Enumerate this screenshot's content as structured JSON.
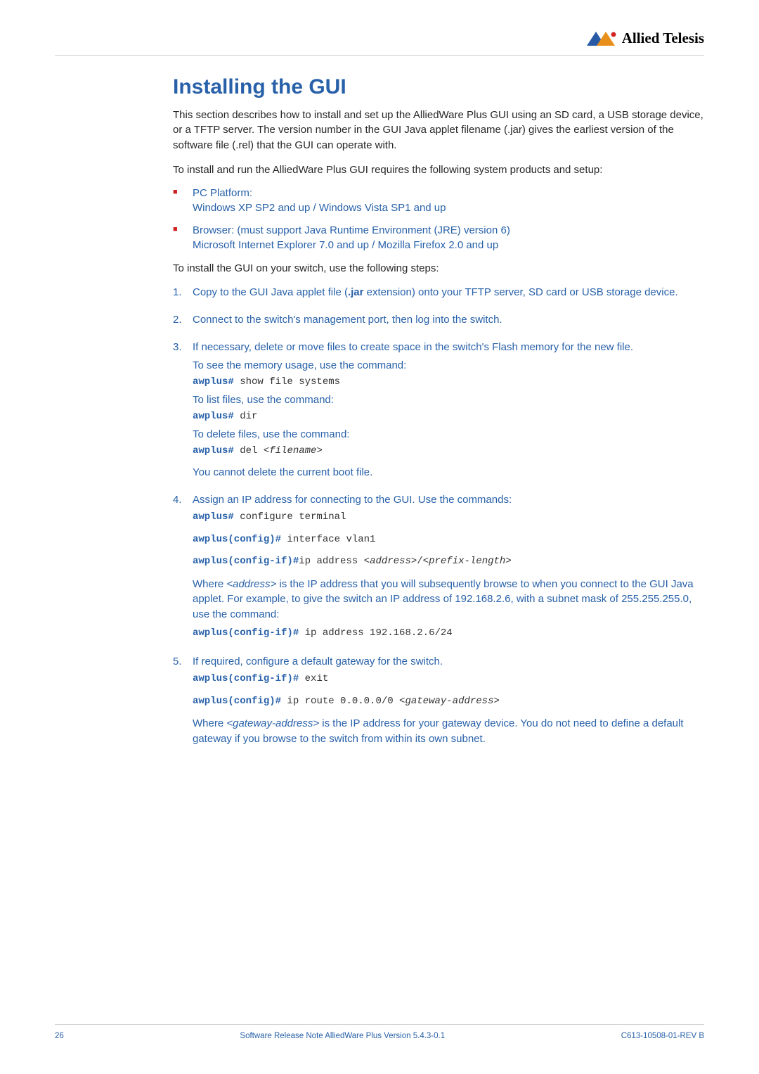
{
  "logo_text": "Allied Telesis",
  "heading": "Installing the GUI",
  "intro1": "This section describes how to install and set up the AlliedWare Plus GUI using an SD card, a USB storage device, or a TFTP server. The version number in the GUI Java applet filename (.jar) gives the earliest version of the software file (.rel) that the GUI can operate with.",
  "intro2": "To install and run the AlliedWare Plus GUI requires the following system products and setup:",
  "bullets": {
    "b1a": "PC Platform:",
    "b1b": "Windows XP SP2 and up / Windows Vista SP1 and up",
    "b2a": "Browser: (must support Java Runtime Environment (JRE) version 6)",
    "b2b": "Microsoft Internet Explorer 7.0 and up / Mozilla Firefox 2.0 and up"
  },
  "follow": "To install the GUI on your switch, use the following steps:",
  "steps": {
    "s1a": "Copy to the GUI Java applet file (",
    "s1b": ".jar",
    "s1c": " extension) onto your TFTP server, SD card or USB storage device.",
    "s2": "Connect to the switch's management port, then log into the switch.",
    "s3": "If necessary, delete or move files to create space in the switch's Flash memory for the new file.",
    "s3_a": "To see the memory usage, use the command:",
    "s3_cmd1_prompt": "awplus#",
    "s3_cmd1_arg": " show file systems",
    "s3_b": "To list files, use the command:",
    "s3_cmd2_prompt": "awplus#",
    "s3_cmd2_arg": " dir",
    "s3_c": "To delete files, use the command:",
    "s3_cmd3_prompt": "awplus#",
    "s3_cmd3_arg1": " del <",
    "s3_cmd3_ital": "filename",
    "s3_cmd3_arg2": ">",
    "s3_d": "You cannot delete the current boot file.",
    "s4": "Assign an IP address for connecting to the GUI. Use the commands:",
    "s4_cmd1_prompt": "awplus#",
    "s4_cmd1_arg": " configure terminal",
    "s4_cmd2_prompt": "awplus(config)#",
    "s4_cmd2_arg": " interface vlan1",
    "s4_cmd3_prompt": "awplus(config-if)#",
    "s4_cmd3_arg1": "ip address <",
    "s4_cmd3_it1": "address",
    "s4_cmd3_arg2": ">/<",
    "s4_cmd3_it2": "prefix-length",
    "s4_cmd3_arg3": ">",
    "s4_p1a": "Where ",
    "s4_p1b": "<address>",
    "s4_p1c": " is the IP address that you will subsequently browse to when you connect to the GUI Java applet. For example, to give the switch an IP address of 192.168.2.6, with a subnet mask of 255.255.255.0, use the command:",
    "s4_cmd4_prompt": "awplus(config-if)#",
    "s4_cmd4_arg": " ip address 192.168.2.6/24",
    "s5": "If required, configure a default gateway for the switch.",
    "s5_cmd1_prompt": "awplus(config-if)#",
    "s5_cmd1_arg": " exit",
    "s5_cmd2_prompt": "awplus(config)#",
    "s5_cmd2_arg1": " ip route 0.0.0.0/0 <",
    "s5_cmd2_it": "gateway-address",
    "s5_cmd2_arg2": ">",
    "s5_p1a": "Where ",
    "s5_p1b": "<gateway-address>",
    "s5_p1c": " is the IP address for your gateway device. You do not need to define a default gateway if you browse to the switch from within its own subnet."
  },
  "footer": {
    "left": "26",
    "center_a": "Software Release Note ",
    "center_b": "AlliedWare Plus Version 5.4.3-0.1",
    "right": "C613-10508-01-REV B"
  }
}
